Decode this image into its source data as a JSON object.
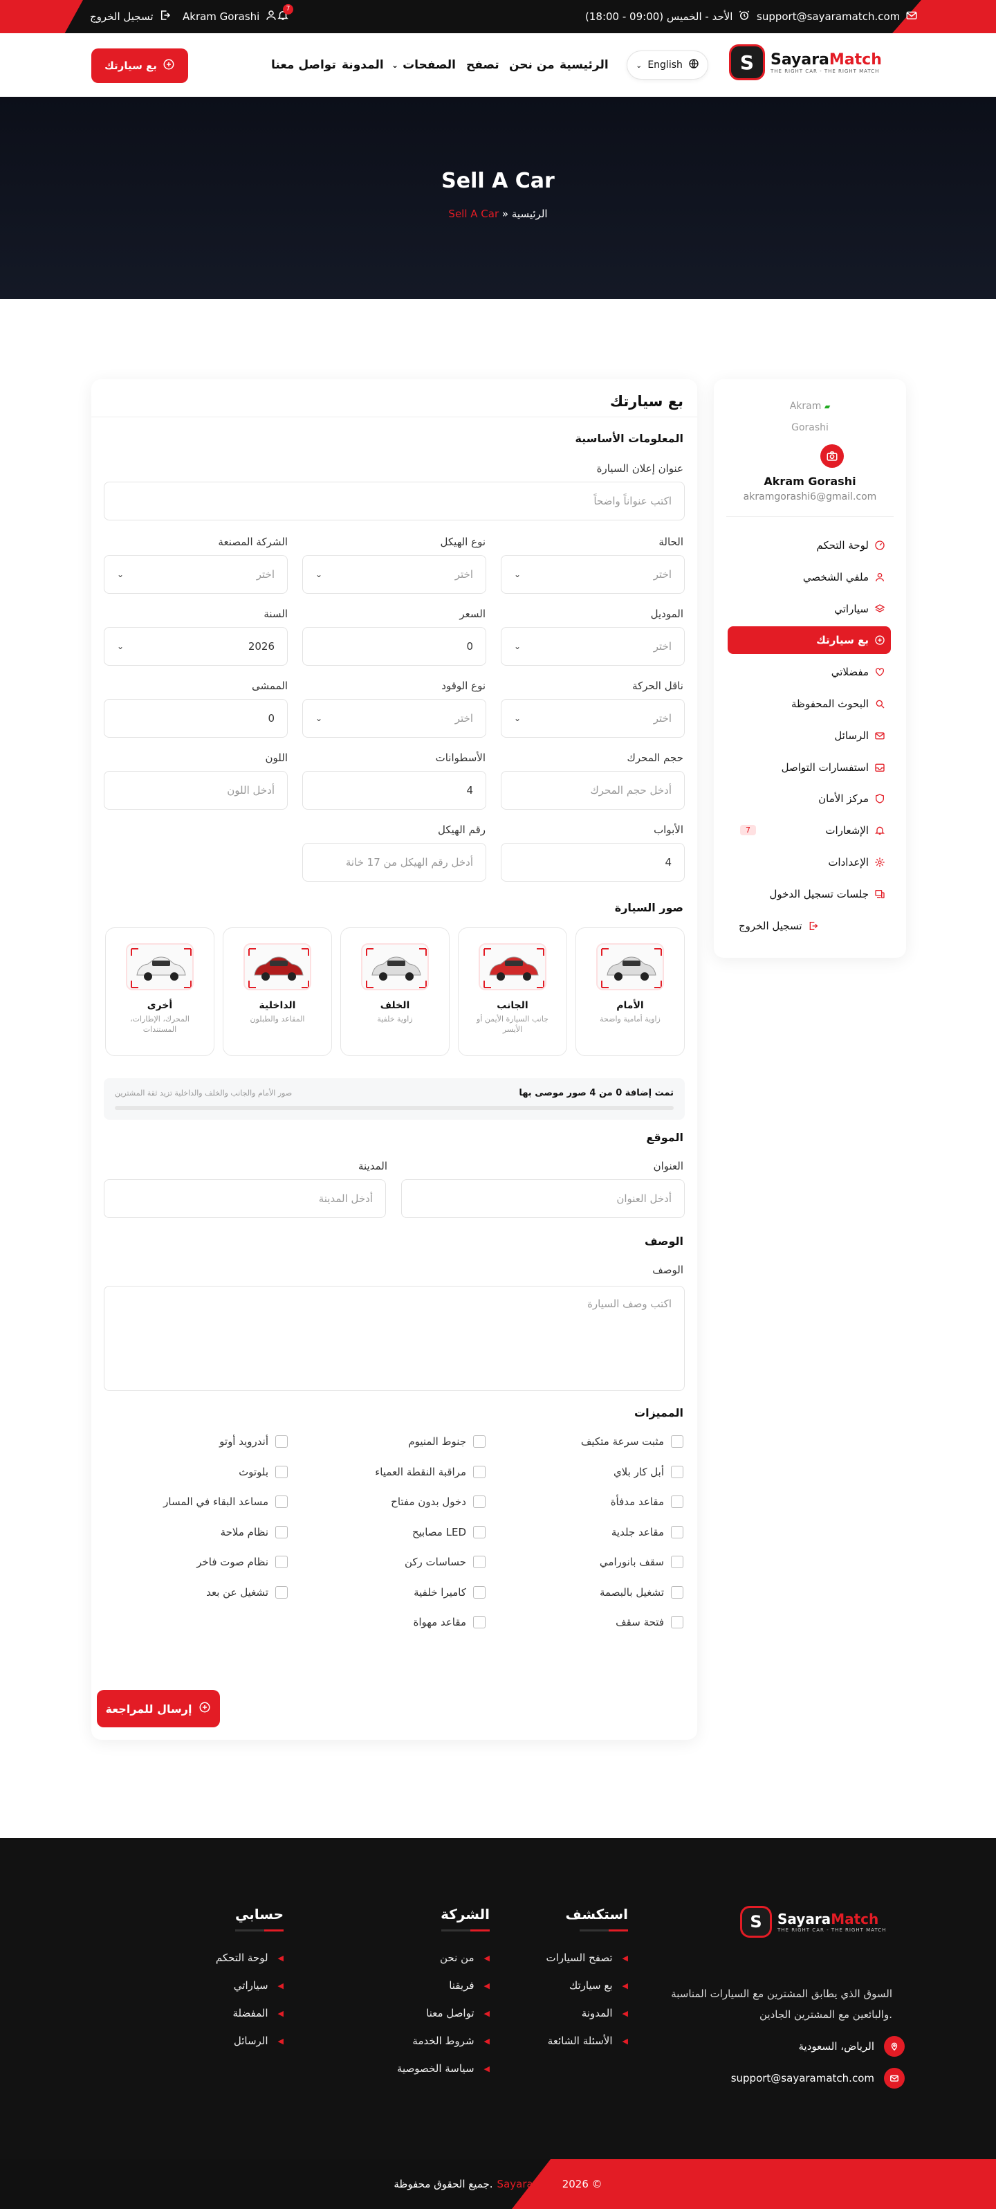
{
  "topbar": {
    "logout": "تسجيل الخروج",
    "user": "Akram Gorashi",
    "notif_count": "7",
    "hours": "الأحد - الخميس (09:00 - 18:00)",
    "email": "support@sayaramatch.com"
  },
  "header": {
    "brand_main": "Sayara",
    "brand_accent": "Match",
    "brand_tagline": "THE RIGHT CAR - THE RIGHT MATCH",
    "language": "English",
    "nav": [
      "الرئيسية",
      "من نحن",
      "تصفح",
      "الصفحات",
      "المدونة",
      "تواصل معنا"
    ],
    "sell_button": "بع سيارتك"
  },
  "hero": {
    "title": "Sell A Car",
    "crumb_home": "الرئيسية",
    "crumb_sep": "»",
    "crumb_current": "Sell A Car"
  },
  "sidebar": {
    "avatar_alt_1": "Akram",
    "avatar_alt_2": "Gorashi",
    "name": "Akram Gorashi",
    "email": "akramgorashi6@gmail.com",
    "items": [
      {
        "label": "لوحة التحكم",
        "icon": "dashboard-icon"
      },
      {
        "label": "ملفي الشخصي",
        "icon": "user-icon"
      },
      {
        "label": "سياراتي",
        "icon": "layers-icon"
      },
      {
        "label": "بع سيارتك",
        "icon": "plus-circle-icon",
        "active": true
      },
      {
        "label": "مفضلاتي",
        "icon": "heart-icon"
      },
      {
        "label": "البحوث المحفوظة",
        "icon": "search-icon"
      },
      {
        "label": "الرسائل",
        "icon": "mail-icon"
      },
      {
        "label": "استفسارات التواصل",
        "icon": "inbox-icon"
      },
      {
        "label": "مركز الأمان",
        "icon": "shield-icon"
      },
      {
        "label": "الإشعارات",
        "icon": "bell-icon",
        "count": "7"
      },
      {
        "label": "الإعدادات",
        "icon": "gear-icon"
      },
      {
        "label": "جلسات تسجيل الدخول",
        "icon": "devices-icon"
      }
    ],
    "logout": "تسجيل الخروج"
  },
  "form": {
    "title": "بع سيارتك",
    "basic_section": "المعلومات الأساسية",
    "ad_title_label": "عنوان إعلان السيارة",
    "ad_title_placeholder": "اكتب عنواناً واضحاً",
    "condition_label": "الحالة",
    "condition_value": "اختر",
    "body_label": "نوع الهيكل",
    "body_value": "اختر",
    "make_label": "الشركة المصنعة",
    "make_value": "اختر",
    "model_label": "الموديل",
    "model_value": "اختر",
    "price_label": "السعر",
    "price_value": "0",
    "year_label": "السنة",
    "year_value": "2026",
    "trans_label": "ناقل الحركة",
    "trans_value": "اختر",
    "fuel_label": "نوع الوقود",
    "fuel_value": "اختر",
    "mileage_label": "الممشى",
    "mileage_value": "0",
    "engine_label": "حجم المحرك",
    "engine_placeholder": "أدخل حجم المحرك",
    "cyl_label": "الأسطوانات",
    "cyl_value": "4",
    "color_label": "اللون",
    "color_placeholder": "أدخل اللون",
    "doors_label": "الأبواب",
    "doors_value": "4",
    "vin_label": "رقم الهيكل",
    "vin_placeholder": "أدخل رقم الهيكل من 17 خانة",
    "photos_section": "صور السيارة",
    "photos": [
      {
        "title": "الأمام",
        "desc": "زاوية أمامية واضحة"
      },
      {
        "title": "الجانب",
        "desc": "جانب السيارة الأيمن أو الأيسر"
      },
      {
        "title": "الخلف",
        "desc": "زاوية خلفية"
      },
      {
        "title": "الداخلية",
        "desc": "المقاعد والطبلون"
      },
      {
        "title": "أخرى",
        "desc": "المحرك، الإطارات، المستندات"
      }
    ],
    "photos_progress": "تمت إضافة 0 من 4 صور موصى بها",
    "photos_hint": "صور الأمام والجانب والخلف والداخلية تزيد ثقة المشترين",
    "photos_fraction": 0,
    "location_section": "الموقع",
    "address_label": "العنوان",
    "address_placeholder": "أدخل العنوان",
    "city_label": "المدينة",
    "city_placeholder": "أدخل المدينة",
    "desc_section": "الوصف",
    "desc_label": "الوصف",
    "desc_placeholder": "اكتب وصف السيارة",
    "features_section": "المميزات",
    "features_col1": [
      "مثبت سرعة متكيف",
      "أبل كار بلاي",
      "مقاعد مدفأة",
      "مقاعد جلدية",
      "سقف بانورامي",
      "تشغيل بالبصمة",
      "فتحة سقف"
    ],
    "features_col2": [
      "جنوط المنيوم",
      "مراقبة النقطة العمياء",
      "دخول بدون مفتاح",
      "مصابيح LED",
      "حساسات ركن",
      "كاميرا خلفية",
      "مقاعد مهواة"
    ],
    "features_col3": [
      "أندرويد أوتو",
      "بلوتوث",
      "مساعد البقاء في المسار",
      "نظام ملاحة",
      "نظام صوت فاخر",
      "تشغيل عن بعد"
    ],
    "submit": "إرسال للمراجعة"
  },
  "footer": {
    "desc_1": "السوق الذي يطابق المشترين مع السيارات المناسبة",
    "desc_2": "والبائعين مع المشترين الجادين.",
    "location": "الرياض، السعودية",
    "email": "support@sayaramatch.com",
    "explore_title": "استكشف",
    "explore": [
      "تصفح السيارات",
      "بع سيارتك",
      "المدونة",
      "الأسئلة الشائعة"
    ],
    "company_title": "الشركة",
    "company": [
      "من نحن",
      "فريقنا",
      "تواصل معنا",
      "شروط الخدمة",
      "سياسة الخصوصية"
    ],
    "account_title": "حسابي",
    "account": [
      "لوحة التحكم",
      "سياراتي",
      "المفضلة",
      "الرسائل"
    ],
    "copyright_year": "2026 ©",
    "copyright_brand": "Sayara",
    "copyright_text": "جميع الحقوق محفوظة."
  },
  "colors": {
    "accent": "#e31c25",
    "dark": "#121212"
  }
}
